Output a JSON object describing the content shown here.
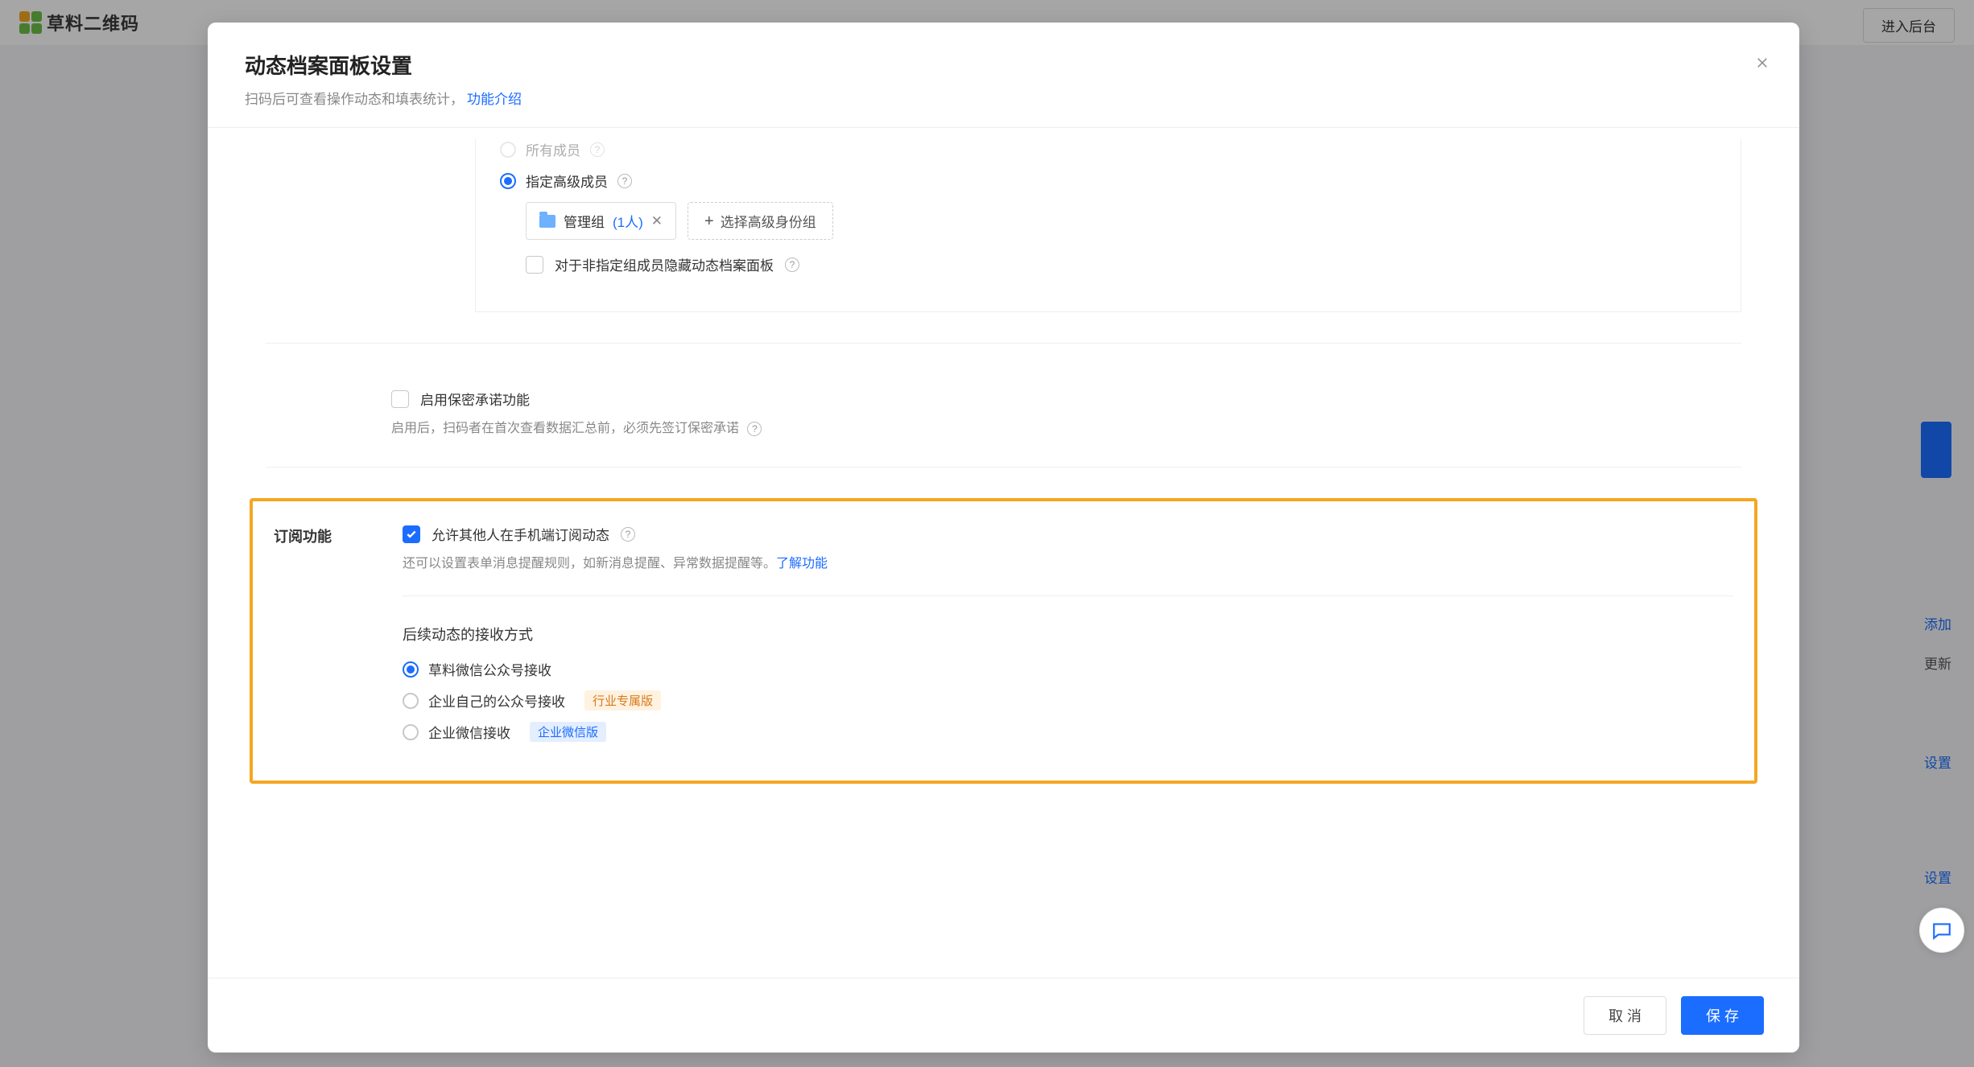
{
  "bg": {
    "logo_text": "草料二维码",
    "enter_btn": "进入后台",
    "side": {
      "add_link": "添加",
      "update_text": "更新",
      "settings_1": "设置",
      "settings_2": "设置"
    }
  },
  "modal": {
    "title": "动态档案面板设置",
    "subtitle_text": "扫码后可查看操作动态和填表统计，",
    "subtitle_link": "功能介绍",
    "perm": {
      "all_members": "所有成员",
      "admin_members": "指定高级成员",
      "group_chip_label": "管理组",
      "group_chip_count": "(1人)",
      "select_group_btn": "选择高级身份组",
      "hide_non_group": "对于非指定组成员隐藏动态档案面板"
    },
    "confidential": {
      "enable_label": "启用保密承诺功能",
      "desc": "启用后，扫码者在首次查看数据汇总前，必须先签订保密承诺"
    },
    "subscribe": {
      "section_label": "订阅功能",
      "allow_label": "允许其他人在手机端订阅动态",
      "desc_prefix": "还可以设置表单消息提醒规则，如新消息提醒、异常数据提醒等。",
      "desc_link": "了解功能",
      "receive_heading": "后续动态的接收方式",
      "options": {
        "caoliao_wechat": "草料微信公众号接收",
        "enterprise_wechat": "企业自己的公众号接收",
        "enterprise_wechat_badge": "行业专属版",
        "wecom": "企业微信接收",
        "wecom_badge": "企业微信版"
      }
    },
    "footer": {
      "cancel": "取 消",
      "save": "保 存"
    }
  }
}
